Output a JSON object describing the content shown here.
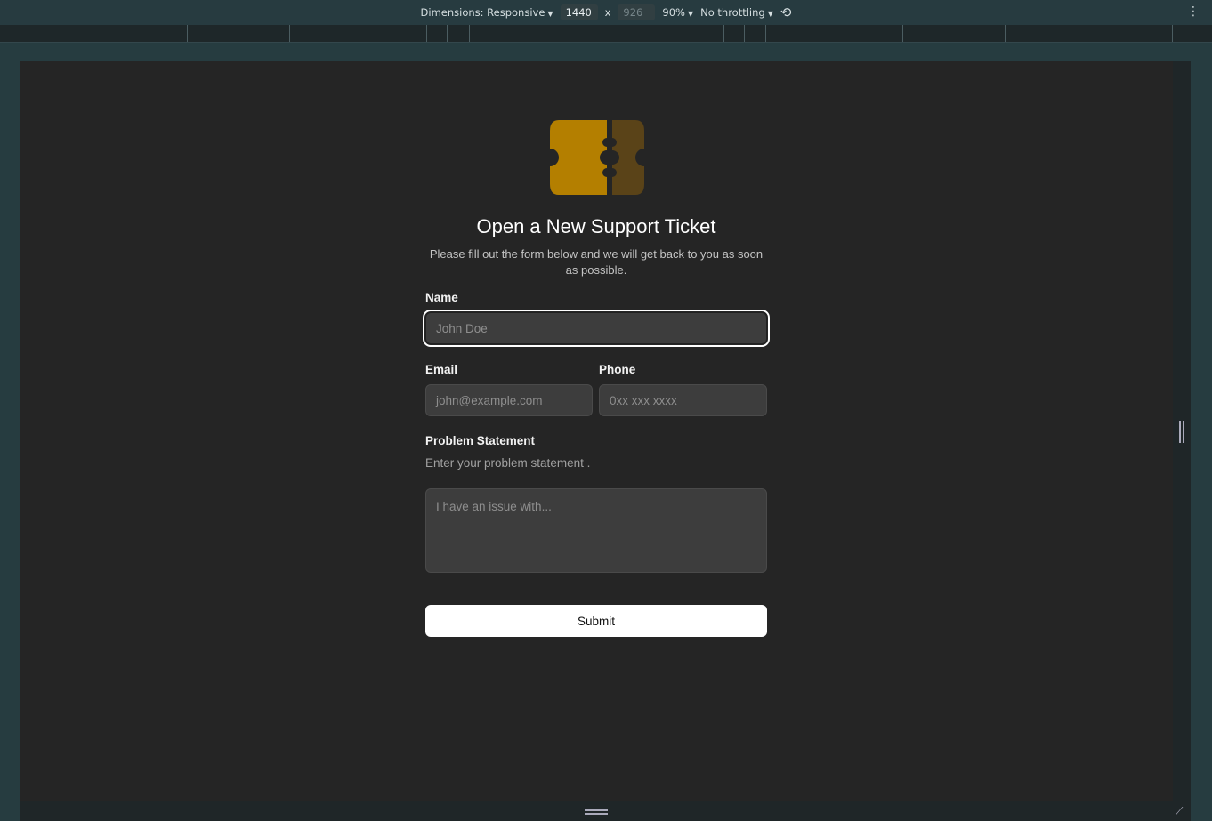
{
  "devtools": {
    "dimensions_label": "Dimensions: Responsive",
    "width": "1440",
    "x": "x",
    "height": "926",
    "zoom": "90%",
    "throttling": "No throttling"
  },
  "brand": {
    "logo_colors": [
      "#b47f00",
      "#5a4318"
    ]
  },
  "form": {
    "title": "Open a New Support Ticket",
    "subtitle": "Please fill out the form below and we will get back to you as soon as possible.",
    "name_label": "Name",
    "name_placeholder": "John Doe",
    "email_label": "Email",
    "email_placeholder": "john@example.com",
    "phone_label": "Phone",
    "phone_placeholder": "0xx xxx xxxx",
    "problem_label": "Problem Statement",
    "problem_description": "Enter your problem statement .",
    "problem_placeholder": "I have an issue with...",
    "submit_label": "Submit"
  }
}
